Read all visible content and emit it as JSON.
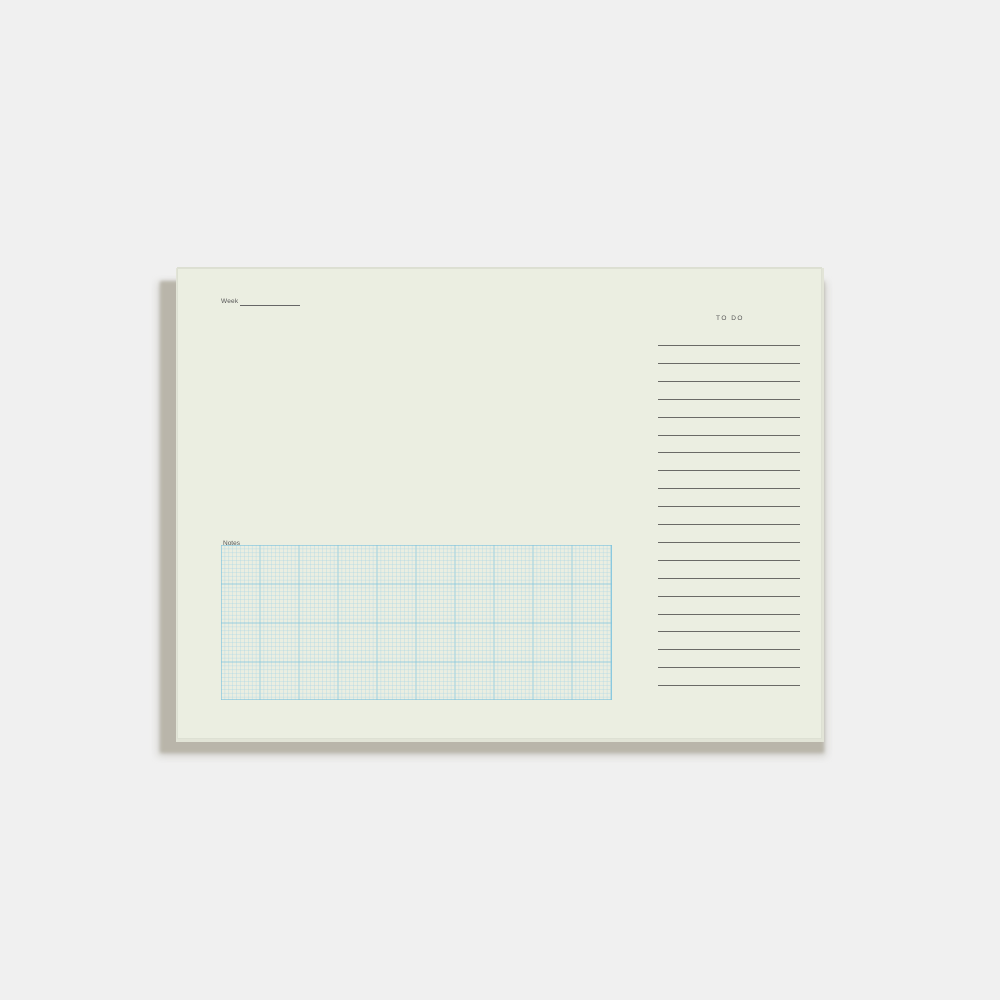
{
  "pad": {
    "week_label": "Week",
    "todo_label": "TO DO",
    "todo_line_count": 20,
    "notes_label": "Notes"
  },
  "colors": {
    "background": "#f0f0f0",
    "paper": "#ebeee1",
    "grid_minor": "#a9d6e6",
    "grid_major": "#7fc4de",
    "rule_lines": "#6a6a66"
  }
}
